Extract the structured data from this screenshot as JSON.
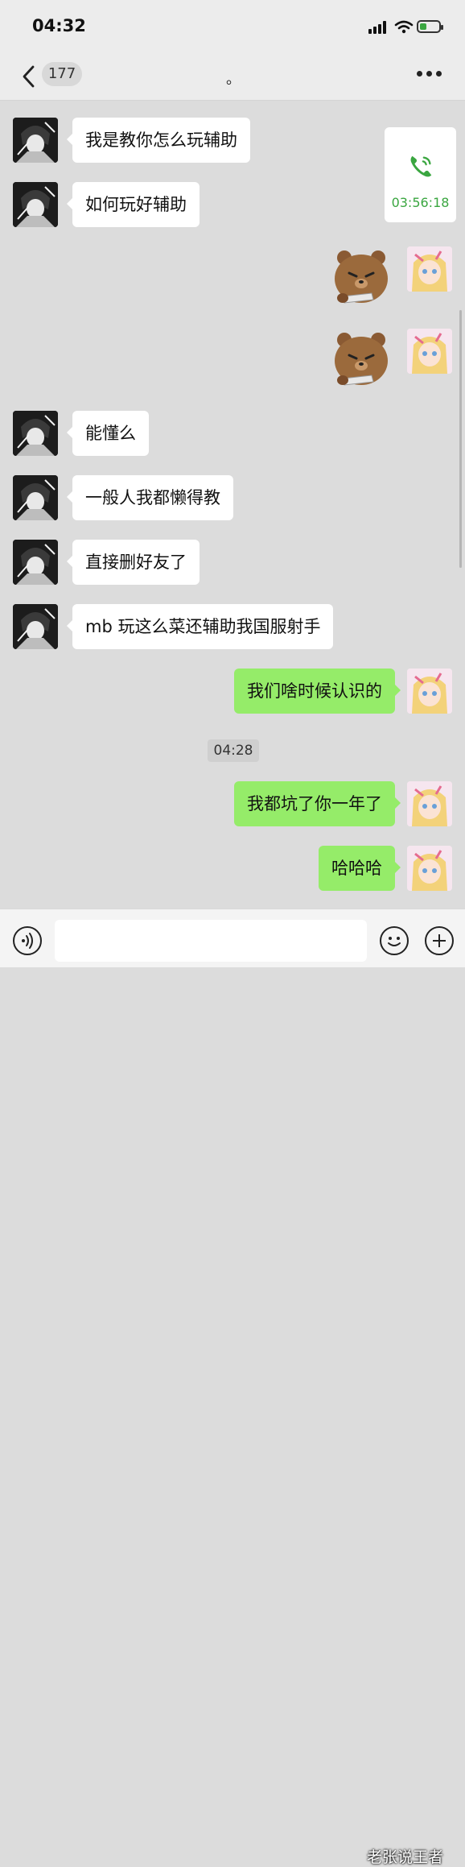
{
  "status_bar": {
    "time": "04:32"
  },
  "nav": {
    "unread_count": "177",
    "title": "。",
    "back_icon": "chevron-left-icon",
    "more_icon": "more-dots-icon"
  },
  "call_record": {
    "duration": "03:56:18",
    "icon": "phone-icon",
    "color": "#3aa640"
  },
  "messages": [
    {
      "sender": "other",
      "text": "我是教你怎么玩辅助"
    },
    {
      "sender": "other",
      "text": "如何玩好辅助"
    },
    {
      "sender": "me",
      "type": "sticker",
      "sticker": "bear-with-knife"
    },
    {
      "sender": "me",
      "type": "sticker",
      "sticker": "bear-with-knife"
    },
    {
      "sender": "other",
      "text": "能懂么"
    },
    {
      "sender": "other",
      "text": "一般人我都懒得教"
    },
    {
      "sender": "other",
      "text": "直接删好友了"
    },
    {
      "sender": "other",
      "text": "mb 玩这么菜还辅助我国服射手"
    },
    {
      "sender": "me",
      "text": "我们啥时候认识的"
    },
    {
      "sender": "me",
      "text": "我都坑了你一年了"
    },
    {
      "sender": "me",
      "text": "哈哈哈"
    }
  ],
  "time_divider": "04:28",
  "input_bar": {
    "voice_icon": "voice-icon",
    "emoji_icon": "emoji-icon",
    "plus_icon": "plus-icon",
    "placeholder": ""
  },
  "watermark": "老张说王者",
  "colors": {
    "outgoing_bubble": "#95ec69",
    "incoming_bubble": "#ffffff",
    "chat_background": "#dcdcdc"
  }
}
